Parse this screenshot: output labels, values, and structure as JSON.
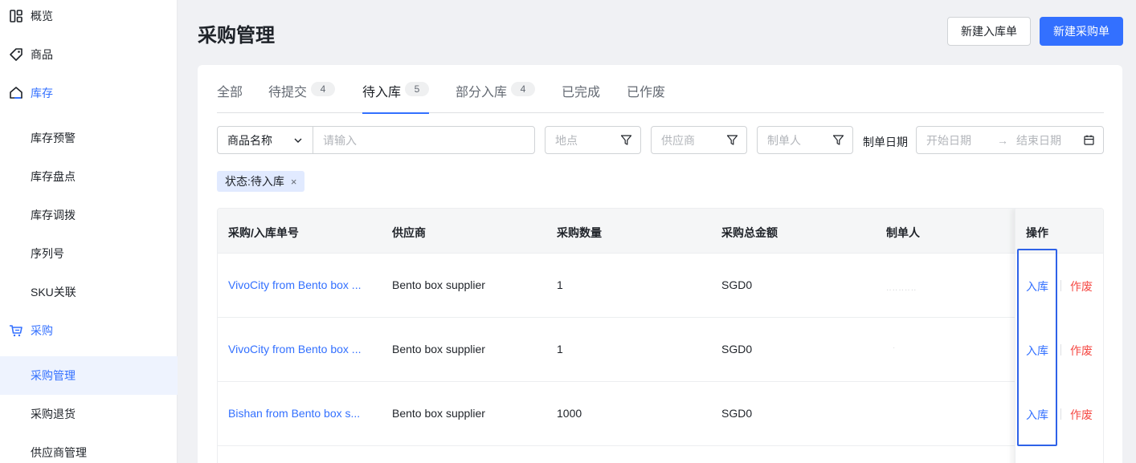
{
  "sidebar": {
    "items": [
      {
        "label": "概览",
        "icon": "overview-icon"
      },
      {
        "label": "商品",
        "icon": "tag-icon"
      },
      {
        "label": "库存",
        "icon": "warehouse-icon"
      },
      {
        "label": "库存预警"
      },
      {
        "label": "库存盘点"
      },
      {
        "label": "库存调拨"
      },
      {
        "label": "序列号"
      },
      {
        "label": "SKU关联"
      },
      {
        "label": "采购",
        "icon": "cart-icon"
      },
      {
        "label": "采购管理"
      },
      {
        "label": "采购退货"
      },
      {
        "label": "供应商管理"
      }
    ]
  },
  "header": {
    "title": "采购管理",
    "btn_new_inbound": "新建入库单",
    "btn_new_purchase": "新建采购单"
  },
  "tabs": [
    {
      "label": "全部",
      "count": ""
    },
    {
      "label": "待提交",
      "count": "4"
    },
    {
      "label": "待入库",
      "count": "5"
    },
    {
      "label": "部分入库",
      "count": "4"
    },
    {
      "label": "已完成",
      "count": ""
    },
    {
      "label": "已作废",
      "count": ""
    }
  ],
  "filters": {
    "field_select": "商品名称",
    "keyword_placeholder": "请输入",
    "location_placeholder": "地点",
    "supplier_placeholder": "供应商",
    "creator_placeholder": "制单人",
    "date_label": "制单日期",
    "start_placeholder": "开始日期",
    "end_placeholder": "结束日期",
    "date_arrow": "→"
  },
  "active_tag": {
    "label": "状态:待入库",
    "close": "×"
  },
  "table": {
    "headers": [
      "采购/入库单号",
      "供应商",
      "采购数量",
      "采购总金额",
      "制单人",
      "操作"
    ],
    "rows": [
      {
        "order": "VivoCity from Bento box ...",
        "supplier": "Bento box supplier",
        "qty": "1",
        "amount": "SGD0",
        "action_in": "入库",
        "action_void": "作废"
      },
      {
        "order": "VivoCity from Bento box ...",
        "supplier": "Bento box supplier",
        "qty": "1",
        "amount": "SGD0",
        "action_in": "入库",
        "action_void": "作废"
      },
      {
        "order": "Bishan from Bento box s...",
        "supplier": "Bento box supplier",
        "qty": "1000",
        "amount": "SGD0",
        "action_in": "入库",
        "action_void": "作废"
      }
    ]
  },
  "colors": {
    "accent": "#3370ff",
    "danger": "#f54a45",
    "highlight_box": "#2e62e8"
  }
}
